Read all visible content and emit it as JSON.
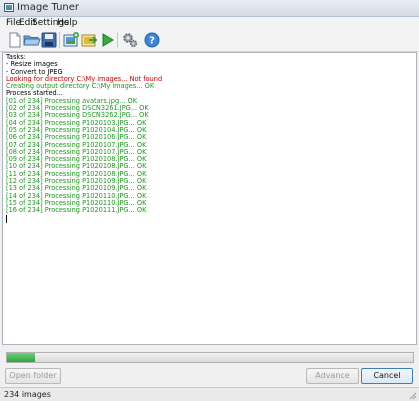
{
  "window": {
    "title": "Image Tuner"
  },
  "menu": {
    "items": [
      "File",
      "Edit",
      "Settings",
      "Help"
    ]
  },
  "toolbar": {
    "icons": [
      "new-file-icon",
      "open-folder-icon",
      "save-icon",
      "add-images-icon",
      "export-icon",
      "run-icon",
      "settings-gears-icon",
      "help-icon"
    ]
  },
  "log": {
    "lines": [
      {
        "text": "Tasks:",
        "color": "#000000"
      },
      {
        "text": " - Resize images",
        "color": "#000000"
      },
      {
        "text": " - Convert to JPEG",
        "color": "#000000"
      },
      {
        "text": "Looking for directory C:\\My images... Not found",
        "color": "#cc0000"
      },
      {
        "text": "Creating output directory C:\\My images... OK",
        "color": "#1a9a1a"
      },
      {
        "text": "Process started...",
        "color": "#000000"
      },
      {
        "text": "[01 of 234] Processing avatars.jpg... OK",
        "color": "#1a9a1a"
      },
      {
        "text": "[02 of 234] Processing DSCN3261.JPG... OK",
        "color": "#1a9a1a"
      },
      {
        "text": "[03 of 234] Processing DSCN3262.JPG... OK",
        "color": "#1a9a1a"
      },
      {
        "text": "[04 of 234] Processing P1020103.JPG... OK",
        "color": "#1a9a1a"
      },
      {
        "text": "[05 of 234] Processing P1020104.JPG... OK",
        "color": "#1a9a1a"
      },
      {
        "text": "[06 of 234] Processing P1020106.JPG... OK",
        "color": "#1a9a1a"
      },
      {
        "text": "[07 of 234] Processing P1020107.JPG... OK",
        "color": "#1a9a1a"
      },
      {
        "text": "[08 of 234] Processing P1020107.JPG... OK",
        "color": "#1a9a1a"
      },
      {
        "text": "[09 of 234] Processing P1020108.JPG... OK",
        "color": "#1a9a1a"
      },
      {
        "text": "[10 of 234] Processing P1020108.JPG... OK",
        "color": "#1a9a1a"
      },
      {
        "text": "[11 of 234] Processing P1020108.JPG... OK",
        "color": "#1a9a1a"
      },
      {
        "text": "[12 of 234] Processing P1020109.JPG... OK",
        "color": "#1a9a1a"
      },
      {
        "text": "[13 of 234] Processing P1020109.JPG... OK",
        "color": "#1a9a1a"
      },
      {
        "text": "[14 of 234] Processing P1020110.JPG... OK",
        "color": "#1a9a1a"
      },
      {
        "text": "[15 of 234] Processing P1020110.JPG... OK",
        "color": "#1a9a1a"
      },
      {
        "text": "[16 of 234] Processing P1020111.JPG... OK",
        "color": "#1a9a1a"
      }
    ]
  },
  "progress": {
    "fraction": 0.068
  },
  "buttons": {
    "open_folder": "Open folder",
    "advance": "Advance",
    "cancel": "Cancel"
  },
  "status": {
    "text": "234 images"
  }
}
